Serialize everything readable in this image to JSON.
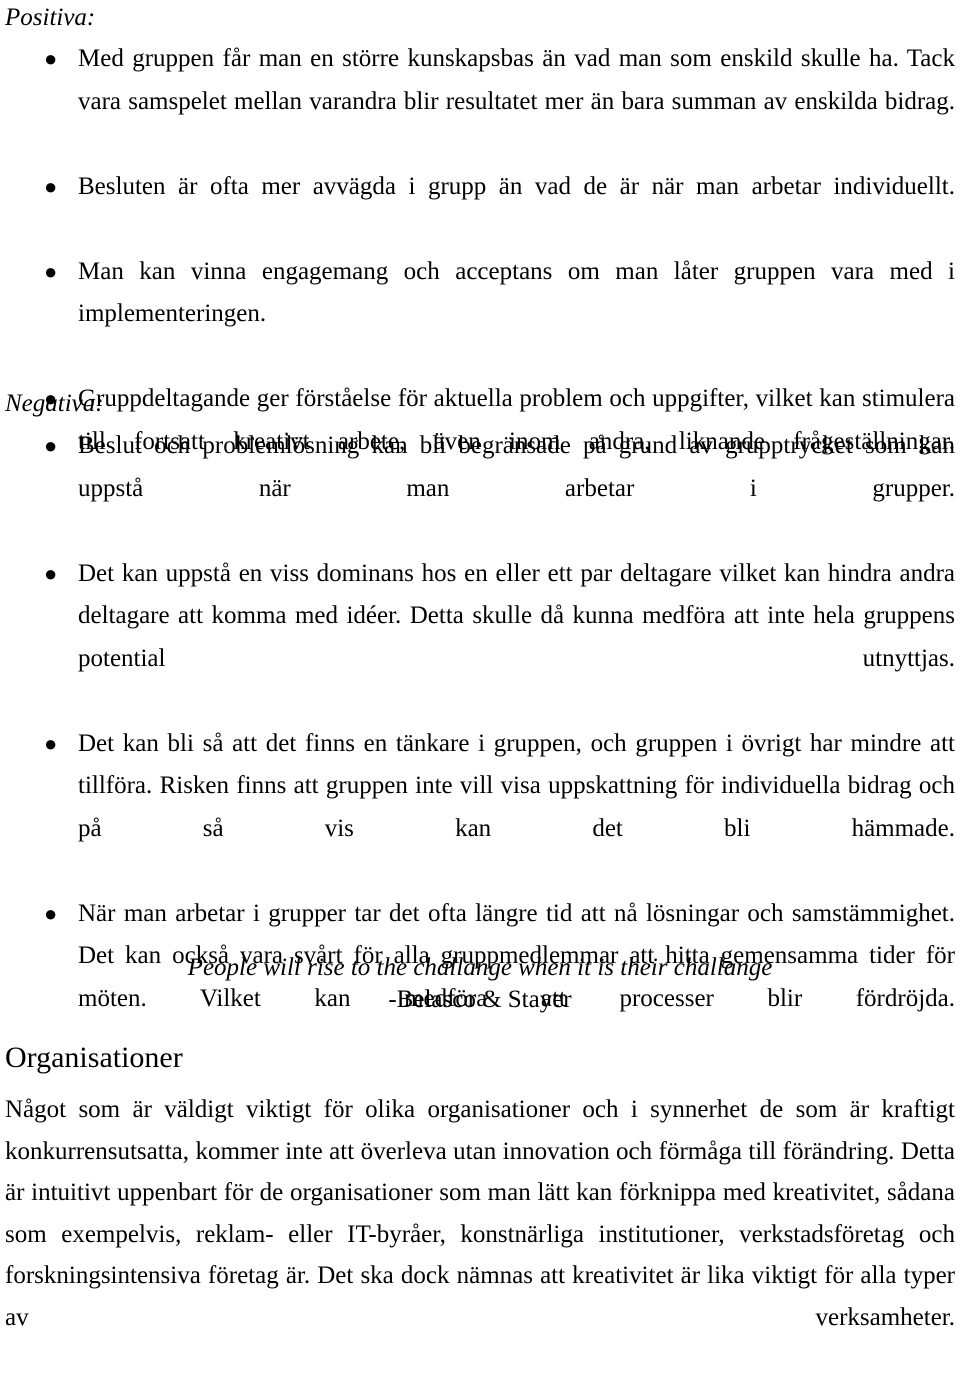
{
  "document": {
    "language": "sv",
    "background_color": "#ffffff",
    "text_color": "#000000"
  },
  "positiva": {
    "label": "Positiva:",
    "bullet_glyph": "●",
    "items": [
      "Med gruppen får man en större kunskapsbas än vad man som enskild skulle ha. Tack vara samspelet mellan varandra blir resultatet mer än bara summan av enskilda bidrag.",
      "Besluten är ofta mer avvägda i grupp än vad de är när man arbetar individuellt.",
      "Man kan vinna engagemang och acceptans om man låter gruppen vara med i implementeringen.",
      "Gruppdeltagande ger förståelse för aktuella problem och uppgifter, vilket kan stimulera till fortsatt kreativt arbete, även inom andra, liknande frågeställningar."
    ]
  },
  "negativa": {
    "label": "Negativa:",
    "bullet_glyph": "●",
    "items": [
      "Beslut och problemlösning kan bli begränsade på grund av grupptrycket som kan uppstå när man arbetar i grupper.",
      "Det kan uppstå en viss dominans hos en eller ett par deltagare vilket kan hindra andra deltagare att komma med idéer. Detta skulle då kunna medföra att inte hela gruppens potential utnyttjas.",
      "Det kan bli så att det finns en tänkare i gruppen, och gruppen i övrigt har mindre att tillföra. Risken finns att gruppen inte vill visa uppskattning för individuella bidrag och på så vis kan det bli hämmade.",
      "När man arbetar i grupper tar det ofta längre tid att nå lösningar och samstämmighet. Det kan också vara svårt för alla gruppmedlemmar att hitta gemensamma tider för möten. Vilket kan medföra att processer blir fördröjda."
    ]
  },
  "quote": {
    "text": "People will rise to the challange when it is their challange",
    "attribution": "-Belasco & Stayer"
  },
  "organisationer": {
    "heading": "Organisationer",
    "paragraphs": [
      "Något som är väldigt viktigt för olika organisationer och i synnerhet de som är kraftigt konkurrensutsatta, kommer inte att överleva utan innovation och förmåga till förändring. Detta är intuitivt uppenbart för de organisationer som man lätt kan förknippa med kreativitet, sådana som exempelvis, reklam- eller IT-byråer, konstnärliga institutioner, verkstadsföretag och forskningsintensiva företag är. Det ska dock nämnas att kreativitet är lika viktigt för alla typer av verksamheter."
    ]
  }
}
